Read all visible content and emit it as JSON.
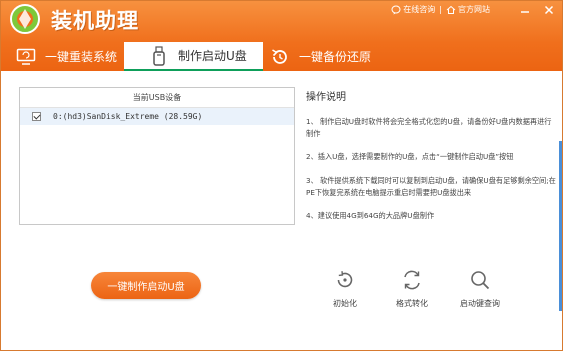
{
  "app": {
    "title": "装机助理"
  },
  "title_actions": {
    "online_consult": "在线咨询",
    "official_site": "官方网站"
  },
  "tabs": [
    {
      "label": "一键重装系统"
    },
    {
      "label": "制作启动U盘"
    },
    {
      "label": "一键备份还原"
    }
  ],
  "device_panel": {
    "header": "当前USB设备",
    "devices": [
      {
        "label": "0:(hd3)SanDisk_Extreme (28.59G)",
        "checked": true
      }
    ]
  },
  "instructions": {
    "title": "操作说明",
    "items": [
      "1、 制作启动U盘时软件将会完全格式化您的U盘，请备份好U盘内数据再进行制作",
      "2、插入U盘，选择需要制作的U盘，点击“一键制作启动U盘”按钮",
      "3、 软件提供系统下载同时可以复制到启动U盘，请确保U盘有足够剩余空间;在PE下恢复完系统在电脑提示重启时需要把U盘拔出来",
      "4、建议使用4G到64G的大品牌U盘制作"
    ]
  },
  "actions": {
    "make_button": "一键制作启动U盘"
  },
  "tools": {
    "init": "初始化",
    "format": "格式转化",
    "query": "启动键查询"
  },
  "colors": {
    "header": "#f06f1c",
    "accent_green": "#0e9f5a",
    "button": "#ec6414"
  }
}
